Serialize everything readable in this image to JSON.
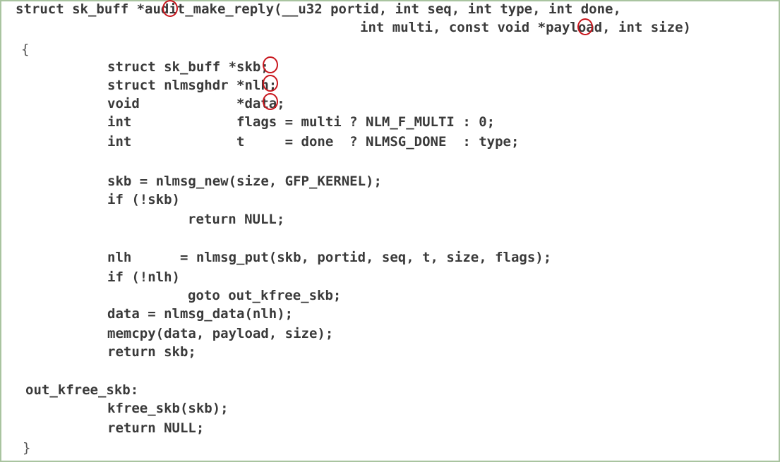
{
  "code": {
    "lines": [
      "struct sk_buff *audit_make_reply(__u32 portid, int seq, int type, int done,",
      "int multi, const void *payload, int size)",
      "{",
      "struct sk_buff *skb;",
      "struct nlmsghdr *nlh;",
      "void            *data;",
      "int             flags = multi ? NLM_F_MULTI : 0;",
      "int             t     = done  ? NLMSG_DONE  : type;",
      "skb = nlmsg_new(size, GFP_KERNEL);",
      "if (!skb)",
      "return NULL;",
      "nlh      = nlmsg_put(skb, portid, seq, t, size, flags);",
      "if (!nlh)",
      "goto out_kfree_skb;",
      "data = nlmsg_data(nlh);",
      "memcpy(data, payload, size);",
      "return skb;",
      "out_kfree_skb:",
      "kfree_skb(skb);",
      "return NULL;",
      "}"
    ]
  },
  "annotations": {
    "highlight_color": "#c8161d",
    "highlighted_token": "*"
  }
}
